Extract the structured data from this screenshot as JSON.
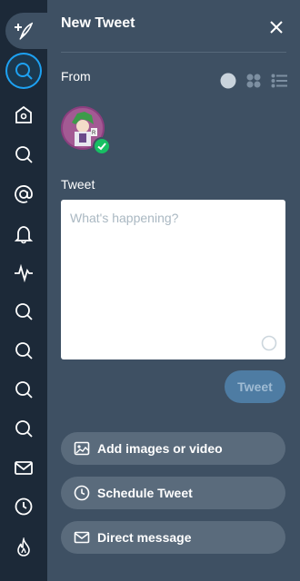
{
  "sidebar": {
    "items": [
      {
        "name": "compose",
        "icon": "compose-feather-icon"
      },
      {
        "name": "search",
        "icon": "search-icon",
        "active": true
      },
      {
        "name": "home",
        "icon": "home-icon"
      },
      {
        "name": "search-column-1",
        "icon": "search-icon"
      },
      {
        "name": "mentions",
        "icon": "at-icon"
      },
      {
        "name": "notifications",
        "icon": "bell-icon"
      },
      {
        "name": "activity",
        "icon": "activity-pulse-icon"
      },
      {
        "name": "search-column-2",
        "icon": "search-icon"
      },
      {
        "name": "search-column-3",
        "icon": "search-icon"
      },
      {
        "name": "search-column-4",
        "icon": "search-icon"
      },
      {
        "name": "search-column-5",
        "icon": "search-icon"
      },
      {
        "name": "messages",
        "icon": "envelope-icon"
      },
      {
        "name": "scheduled",
        "icon": "clock-icon"
      },
      {
        "name": "trending",
        "icon": "flame-icon"
      }
    ]
  },
  "panel": {
    "title": "New Tweet",
    "from_label": "From",
    "tweet_label": "Tweet",
    "placeholder": "What's happening?",
    "tweet_button": "Tweet",
    "actions": {
      "images": "Add images or video",
      "schedule": "Schedule Tweet",
      "dm": "Direct message"
    }
  },
  "colors": {
    "sidebar_bg": "#1c2938",
    "panel_bg": "#3e5063",
    "accent": "#1da1f2",
    "verified": "#17bf63",
    "tweet_button_bg": "#4e7ca3",
    "action_button_bg": "#5a6b7c"
  }
}
